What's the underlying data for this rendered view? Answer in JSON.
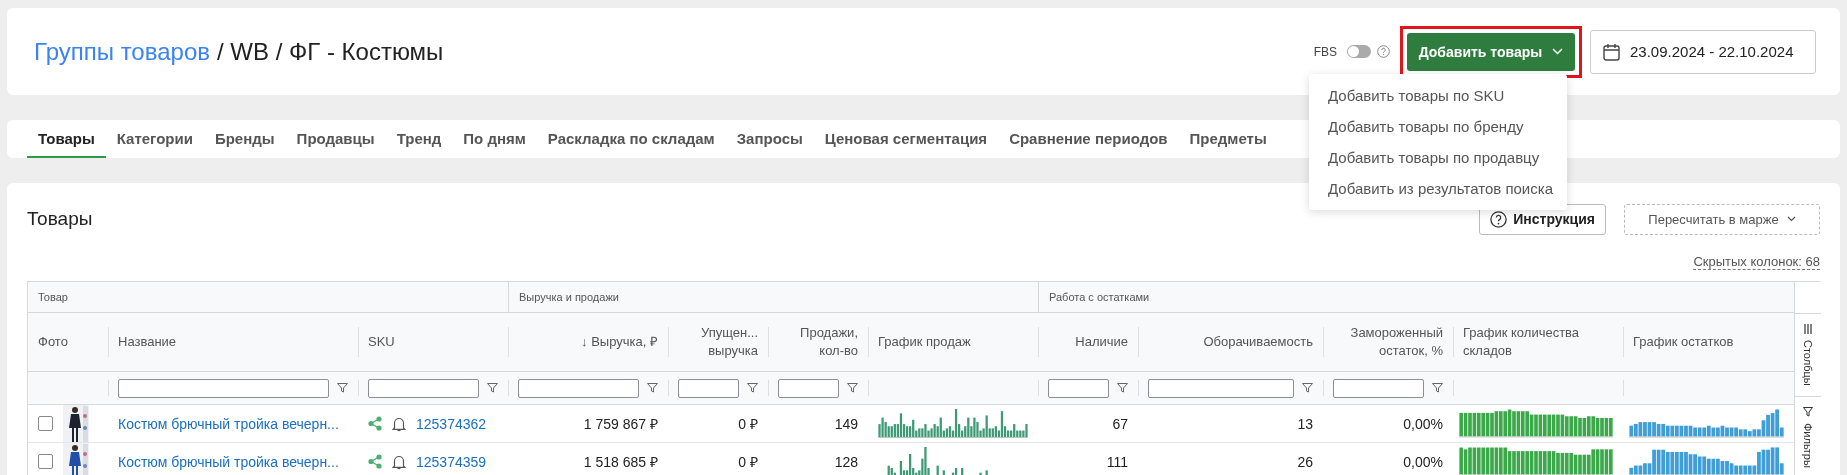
{
  "breadcrumb": {
    "link": "Группы товаров",
    "rest": "/ WB / ФГ - Костюмы"
  },
  "fbs": {
    "label": "FBS",
    "on": false
  },
  "add_button": {
    "label": "Добавить товары",
    "highlighted": true,
    "expanded": true
  },
  "add_menu": [
    "Добавить товары по SKU",
    "Добавить товары по бренду",
    "Добавить товары по продавцу",
    "Добавить из результатов поиска"
  ],
  "date_range": "23.09.2024 - 22.10.2024",
  "tabs": [
    {
      "label": "Товары",
      "selected": true
    },
    {
      "label": "Категории",
      "selected": false
    },
    {
      "label": "Бренды",
      "selected": false
    },
    {
      "label": "Продавцы",
      "selected": false
    },
    {
      "label": "Тренд",
      "selected": false
    },
    {
      "label": "По дням",
      "selected": false
    },
    {
      "label": "Раскладка по складам",
      "selected": false
    },
    {
      "label": "Запросы",
      "selected": false
    },
    {
      "label": "Ценовая сегментация",
      "selected": false
    },
    {
      "label": "Сравнение периодов",
      "selected": false
    },
    {
      "label": "Предметы",
      "selected": false
    }
  ],
  "section": {
    "title": "Товары",
    "help_button": "Инструкция",
    "recalc_select": "Пересчитать в марже",
    "hidden_columns": "Скрытых колонок: 68"
  },
  "table": {
    "groups": [
      {
        "label": "Товар",
        "columns": [
          {
            "label": "Фото",
            "filter": false
          },
          {
            "label": "Название",
            "filter": true
          },
          {
            "label": "SKU",
            "filter": true
          }
        ]
      },
      {
        "label": "Выручка и продажи",
        "columns": [
          {
            "label": "Выручка, ₽",
            "sort_mark": "↓",
            "filter": true
          },
          {
            "label": "Упущен...\nвыручка",
            "filter": true
          },
          {
            "label": "Продажи,\nкол-во",
            "filter": true
          },
          {
            "label": "График продаж",
            "filter": false
          }
        ]
      },
      {
        "label": "Работа с остатками",
        "columns": [
          {
            "label": "Наличие",
            "filter": true
          },
          {
            "label": "Оборачиваемость",
            "filter": true
          },
          {
            "label": "Замороженный\nостаток, %",
            "filter": true
          },
          {
            "label": "График количества\nскладов",
            "filter": false
          },
          {
            "label": "График остатков",
            "filter": false
          }
        ]
      }
    ],
    "side_tabs": [
      "Столбцы",
      "Фильтры"
    ],
    "rows": [
      {
        "checked": false,
        "name": "Костюм брючный тройка вечерн...",
        "sku": "125374362",
        "revenue": "1 759 867 ₽",
        "lost_revenue": "0 ₽",
        "sales": "149",
        "stock": "67",
        "turnover": "13",
        "frozen": "0,00%"
      },
      {
        "checked": false,
        "name": "Костюм брючный тройка вечерн...",
        "sku": "125374359",
        "revenue": "1 518 685 ₽",
        "lost_revenue": "0 ₽",
        "sales": "128",
        "stock": "111",
        "turnover": "26",
        "frozen": "0,00%"
      }
    ]
  }
}
